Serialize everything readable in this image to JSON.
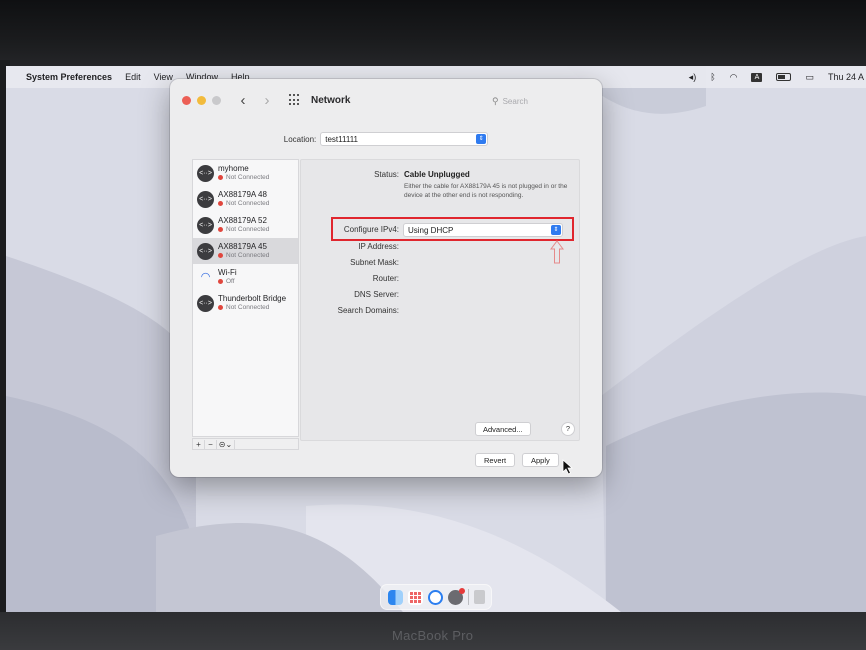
{
  "menubar": {
    "app_name": "System Preferences",
    "items": [
      "Edit",
      "View",
      "Window",
      "Help"
    ],
    "clock": "Thu 24 A",
    "input_source": "A"
  },
  "window": {
    "title": "Network",
    "search_placeholder": "Search",
    "location_label": "Location:",
    "location_value": "test11111"
  },
  "services": [
    {
      "name": "myhome",
      "status": "Not Connected",
      "icon": "ethernet-icon",
      "selected": false
    },
    {
      "name": "AX88179A 48",
      "status": "Not Connected",
      "icon": "ethernet-icon",
      "selected": false
    },
    {
      "name": "AX88179A 52",
      "status": "Not Connected",
      "icon": "ethernet-icon",
      "selected": false
    },
    {
      "name": "AX88179A 45",
      "status": "Not Connected",
      "icon": "ethernet-icon",
      "selected": true
    },
    {
      "name": "Wi-Fi",
      "status": "Off",
      "icon": "wifi-icon",
      "selected": false
    },
    {
      "name": "Thunderbolt Bridge",
      "status": "Not Connected",
      "icon": "ethernet-icon",
      "selected": false
    }
  ],
  "sidebar_footer": {
    "add": "+",
    "remove": "−",
    "more": "⊝⌄"
  },
  "detail": {
    "status_label": "Status:",
    "status_value": "Cable Unplugged",
    "status_description": "Either the cable for AX88179A 45 is not plugged in or the device at the other end is not responding.",
    "configure_label": "Configure IPv4:",
    "configure_value": "Using DHCP",
    "fields": [
      "IP Address:",
      "Subnet Mask:",
      "Router:",
      "DNS Server:",
      "Search Domains:"
    ],
    "advanced_button": "Advanced...",
    "help_button": "?",
    "revert_button": "Revert",
    "apply_button": "Apply"
  },
  "laptop_brand": "MacBook Pro",
  "colors": {
    "highlight_box": "#e0262e",
    "status_dot": "#e0463d",
    "accent": "#2f7bf0"
  }
}
